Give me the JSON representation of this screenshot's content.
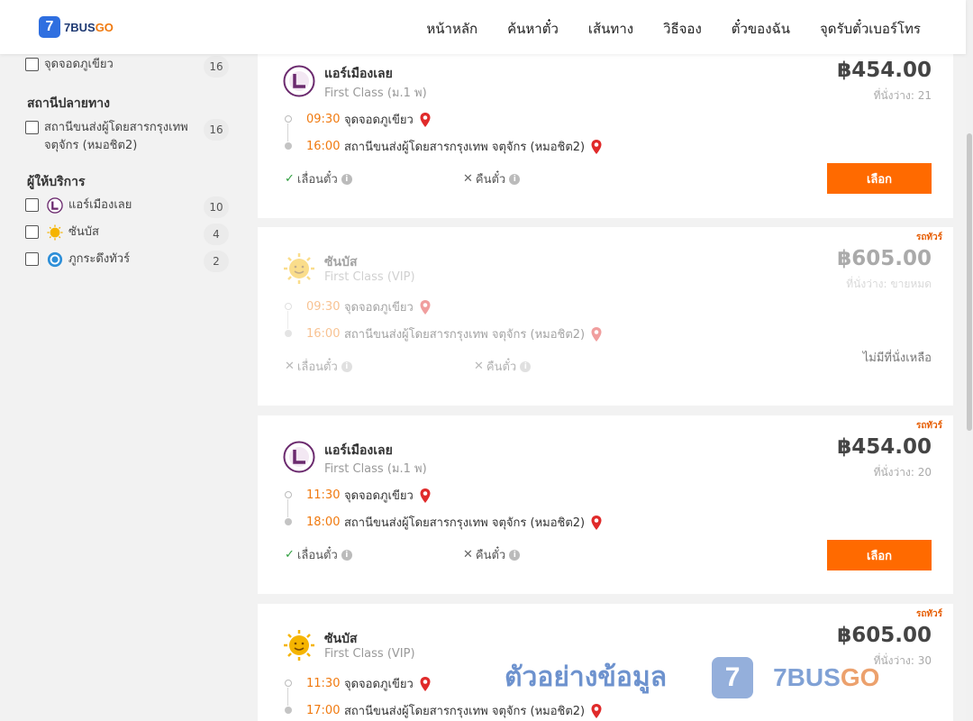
{
  "header": {
    "logo_num": "7",
    "logo_text_a": "7BUS",
    "logo_text_b": "GO",
    "nav": [
      "หน้าหลัก",
      "ค้นหาตั๋ว",
      "เส้นทาง",
      "วิธีจอง",
      "ตั๋วของฉัน",
      "จุดรับตั๋วเบอร์โทร"
    ]
  },
  "sidebar": {
    "origin_item": {
      "label": "จุดจอดภูเขียว",
      "count": "16"
    },
    "dest_title": "สถานีปลายทาง",
    "dest_item": {
      "label": "สถานีขนส่งผู้โดยสารกรุงเทพ จตุจักร (หมอชิต2)",
      "count": "16"
    },
    "op_title": "ผู้ให้บริการ",
    "operators": [
      {
        "label": "แอร์เมืองเลย",
        "count": "10",
        "icon": "air-muang-loei-logo"
      },
      {
        "label": "ซันบัส",
        "count": "4",
        "icon": "sun-logo"
      },
      {
        "label": "ภูกระดึงทัวร์",
        "count": "2",
        "icon": "phukradueng-logo"
      }
    ]
  },
  "cards": [
    {
      "operator": "แอร์เมืองเลย",
      "class": "First Class (ม.1 พ)",
      "price": "฿454.00",
      "seats": "ที่นั่งว่าง: 21",
      "tag": "",
      "depart_time": "09:30",
      "depart_place": "จุดจอดภูเขียว",
      "arrive_time": "16:00",
      "arrive_place": "สถานีขนส่งผู้โดยสารกรุงเทพ จตุจักร (หมอชิต2)",
      "change": "เลื่อนตั๋ว",
      "refund": "คืนตั๋ว",
      "button": "เลือก"
    },
    {
      "operator": "ซันบัส",
      "class": "First Class (VIP)",
      "price": "฿605.00",
      "seats": "ที่นั่งว่าง: ขายหมด",
      "tag": "รถทัวร์",
      "depart_time": "09:30",
      "depart_place": "จุดจอดภูเขียว",
      "arrive_time": "16:00",
      "arrive_place": "สถานีขนส่งผู้โดยสารกรุงเทพ จตุจักร (หมอชิต2)",
      "change": "เลื่อนตั๋ว",
      "refund": "คืนตั๋ว",
      "no_seat": "ไม่มีที่นั่งเหลือ"
    },
    {
      "operator": "แอร์เมืองเลย",
      "class": "First Class (ม.1 พ)",
      "price": "฿454.00",
      "seats": "ที่นั่งว่าง: 20",
      "tag": "รถทัวร์",
      "depart_time": "11:30",
      "depart_place": "จุดจอดภูเขียว",
      "arrive_time": "18:00",
      "arrive_place": "สถานีขนส่งผู้โดยสารกรุงเทพ จตุจักร (หมอชิต2)",
      "change": "เลื่อนตั๋ว",
      "refund": "คืนตั๋ว",
      "button": "เลือก"
    },
    {
      "operator": "ซันบัส",
      "class": "First Class (VIP)",
      "price": "฿605.00",
      "seats": "ที่นั่งว่าง: 30",
      "tag": "รถทัวร์",
      "depart_time": "11:30",
      "depart_place": "จุดจอดภูเขียว",
      "arrive_time": "17:00",
      "arrive_place": "สถานีขนส่งผู้โดยสารกรุงเทพ จตุจักร (หมอชิต2)"
    }
  ],
  "watermark": {
    "text": "ตัวอย่างข้อมูล",
    "logo_num": "7",
    "brand_a": "7BUS",
    "brand_b": "GO"
  },
  "colors": {
    "accent": "#ff6a00",
    "time": "#f07a10",
    "pin": "#e02a2a",
    "check": "#2e9e3e"
  }
}
